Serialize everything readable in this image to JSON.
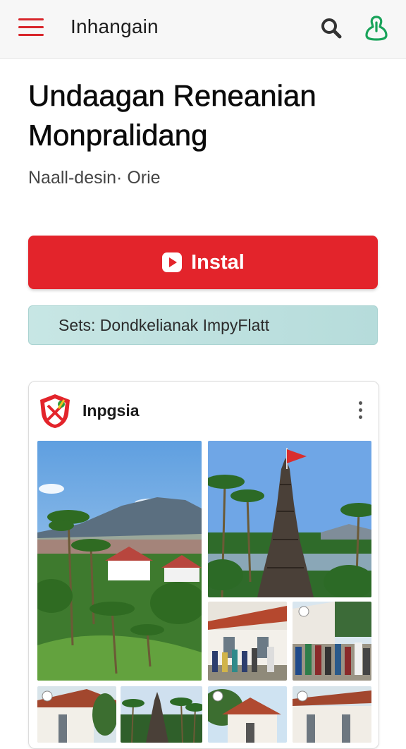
{
  "header": {
    "title": "Inhangain",
    "menu_icon": "hamburger-menu-icon",
    "search_icon": "search-icon",
    "account_icon": "account-icon",
    "accent_color": "#d8262b",
    "account_color": "#19a35a"
  },
  "content": {
    "headline_line1": "Undaagan Reneanian",
    "headline_line2": "Monpralidang",
    "subline": "Naall-desin· Orie"
  },
  "install": {
    "label": "Instal",
    "icon": "play-icon",
    "color": "#e3242b"
  },
  "sets_bar": {
    "label": "Sets: Dondkelianak ImpyFlatt"
  },
  "card": {
    "name": "Inpgsia",
    "logo_icon": "shield-logo-icon",
    "more_icon": "more-vertical-icon",
    "photos": [
      "village-landscape-photo",
      "temple-monument-photo",
      "school-gathering-photo",
      "crowd-gathering-photo",
      "building-photo",
      "temple-spire-photo",
      "house-photo",
      "building-photo"
    ]
  }
}
